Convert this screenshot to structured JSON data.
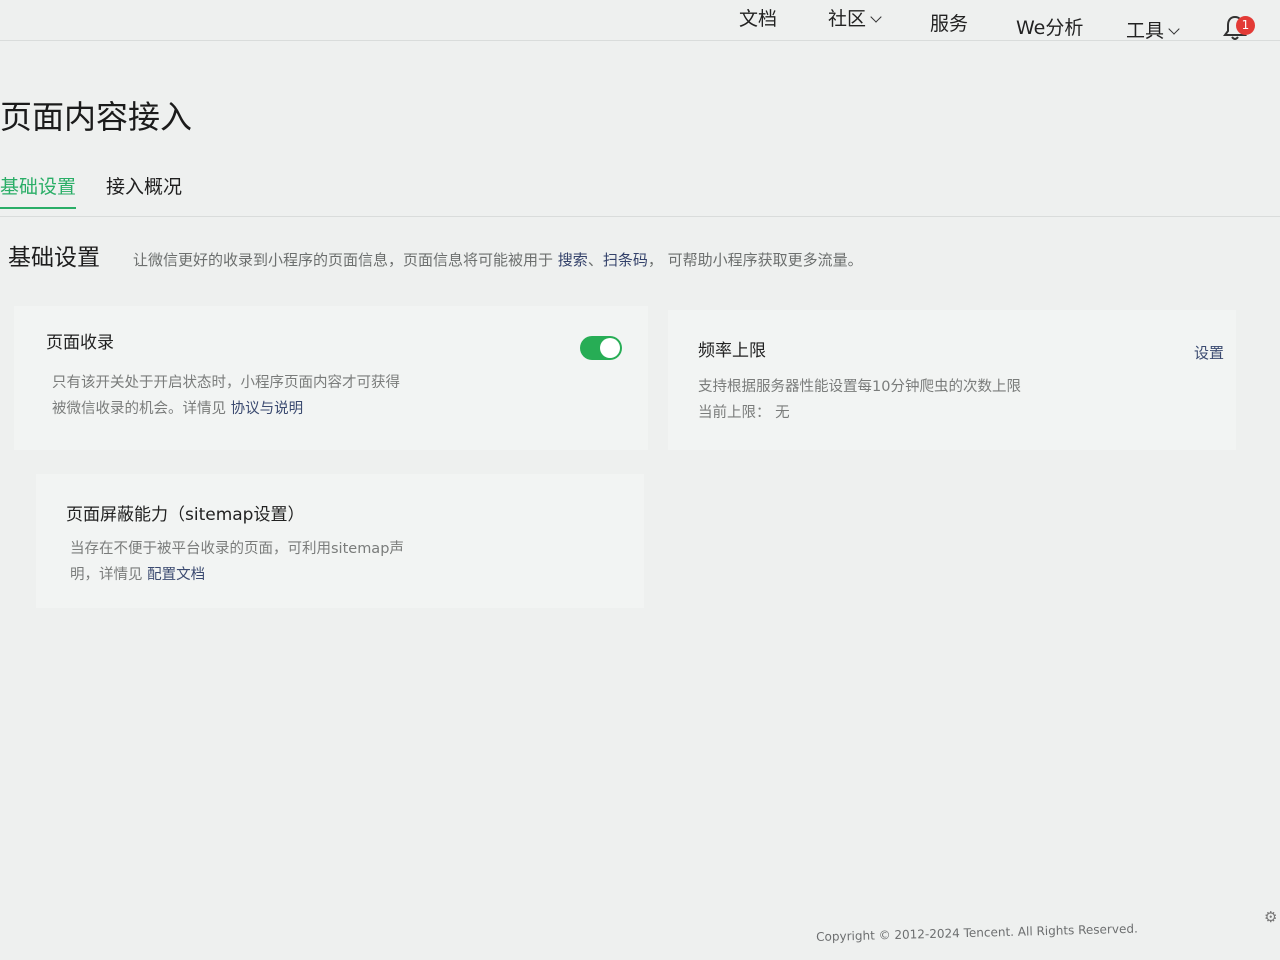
{
  "nav": {
    "items": [
      "文档",
      "社区",
      "服务",
      "We分析",
      "工具"
    ],
    "notification_count": "1"
  },
  "page": {
    "title": "页面内容接入",
    "tabs": [
      {
        "label": "基础设置",
        "active": true
      },
      {
        "label": "接入概况",
        "active": false
      }
    ]
  },
  "section": {
    "title": "基础设置",
    "desc_prefix": "让微信更好的收录到小程序的页面信息，页面信息将可能被用于",
    "desc_link1": "搜索",
    "desc_sep": "、",
    "desc_link2": "扫条码",
    "desc_suffix": "，  可帮助小程序获取更多流量。"
  },
  "cards": {
    "page_index": {
      "title": "页面收录",
      "line1": "只有该开关处于开启状态时，小程序页面内容才可获得",
      "line2_prefix": "被微信收录的机会。详情见",
      "line2_link": "协议与说明",
      "toggle_on": true
    },
    "rate_limit": {
      "title": "频率上限",
      "action": "设置",
      "line1": "支持根据服务器性能设置每10分钟爬虫的次数上限",
      "line2_label": "当前上限：",
      "line2_value": "无"
    },
    "sitemap": {
      "title": "页面屏蔽能力（sitemap设置）",
      "line1": "当存在不便于被平台收录的页面，可利用sitemap声",
      "line2_prefix": "明，详情见",
      "line2_link": "配置文档"
    }
  },
  "footer": {
    "copyright": "Copyright © 2012-2024 Tencent. All Rights Reserved."
  },
  "colors": {
    "accent_green": "#2aae67",
    "toggle_green": "#27ad55",
    "badge_red": "#e33b36"
  },
  "icons": [
    "chevron-down-icon",
    "bell-icon",
    "gear-icon"
  ]
}
